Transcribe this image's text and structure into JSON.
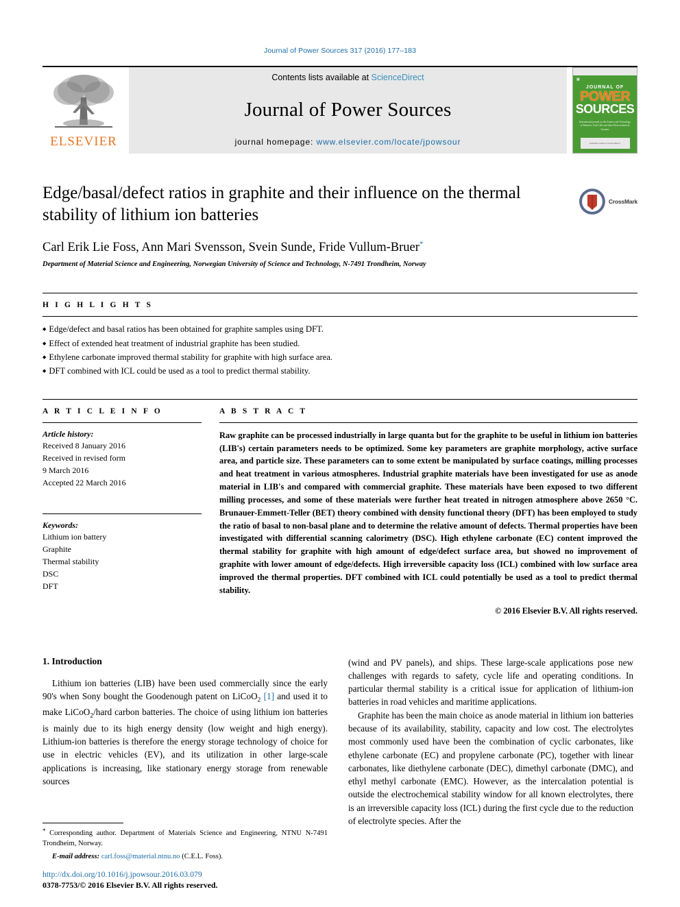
{
  "running_head": "Journal of Power Sources 317 (2016) 177–183",
  "masthead": {
    "publisher_name": "ELSEVIER",
    "contents_prefix": "Contents lists available at ",
    "contents_link": "ScienceDirect",
    "journal_name": "Journal of Power Sources",
    "homepage_prefix": "journal homepage: ",
    "homepage_url": "www.elsevier.com/locate/jpowsour",
    "cover": {
      "line1": "JOURNAL OF",
      "line2": "POWER",
      "line3": "SOURCES",
      "blurb": "International journal on the Science and Technology of Batteries, Fuel Cells and other Electrochemical Systems",
      "footer": "Available online at ScienceDirect"
    }
  },
  "article": {
    "title": "Edge/basal/defect ratios in graphite and their influence on the thermal stability of lithium ion batteries",
    "authors": "Carl Erik Lie Foss, Ann Mari Svensson, Svein Sunde, Fride Vullum-Bruer",
    "author_star": "*",
    "affiliation": "Department of Material Science and Engineering, Norwegian University of Science and Technology, N-7491 Trondheim, Norway",
    "crossmark_label": "CrossMark"
  },
  "highlights": {
    "heading": "H I G H L I G H T S",
    "items": [
      "Edge/defect and basal ratios has been obtained for graphite samples using DFT.",
      "Effect of extended heat treatment of industrial graphite has been studied.",
      "Ethylene carbonate improved thermal stability for graphite with high surface area.",
      "DFT combined with ICL could be used as a tool to predict thermal stability."
    ]
  },
  "article_info": {
    "heading": "A R T I C L E   I N F O",
    "history_label": "Article history:",
    "history": [
      "Received 8 January 2016",
      "Received in revised form",
      "9 March 2016",
      "Accepted 22 March 2016"
    ],
    "keywords_label": "Keywords:",
    "keywords": [
      "Lithium ion battery",
      "Graphite",
      "Thermal stability",
      "DSC",
      "DFT"
    ]
  },
  "abstract": {
    "heading": "A B S T R A C T",
    "text": "Raw graphite can be processed industrially in large quanta but for the graphite to be useful in lithium ion batteries (LIB's) certain parameters needs to be optimized. Some key parameters are graphite morphology, active surface area, and particle size. These parameters can to some extent be manipulated by surface coatings, milling processes and heat treatment in various atmospheres. Industrial graphite materials have been investigated for use as anode material in LIB's and compared with commercial graphite. These materials have been exposed to two different milling processes, and some of these materials were further heat treated in nitrogen atmosphere above 2650 °C. Brunauer-Emmett-Teller (BET) theory combined with density functional theory (DFT) has been employed to study the ratio of basal to non-basal plane and to determine the relative amount of defects. Thermal properties have been investigated with differential scanning calorimetry (DSC). High ethylene carbonate (EC) content improved the thermal stability for graphite with high amount of edge/defect surface area, but showed no improvement of graphite with lower amount of edge/defects. High irreversible capacity loss (ICL) combined with low surface area improved the thermal properties. DFT combined with ICL could potentially be used as a tool to predict thermal stability.",
    "copyright": "© 2016 Elsevier B.V. All rights reserved."
  },
  "introduction": {
    "heading": "1. Introduction",
    "left_p1_a": "Lithium ion batteries (LIB) have been used commercially since the early 90's when Sony bought the Goodenough patent on LiCoO",
    "left_p1_sub1": "2",
    "left_p1_ref": "[1]",
    "left_p1_b": " and used it to make LiCoO",
    "left_p1_sub2": "2",
    "left_p1_c": "/hard carbon batteries. The choice of using lithium ion batteries is mainly due to its high energy density (low weight and high energy). Lithium-ion batteries is therefore the energy storage technology of choice for use in electric vehicles (EV), and its utilization in other large-scale applications is increasing, like stationary energy storage from renewable sources",
    "right_p1": "(wind and PV panels), and ships. These large-scale applications pose new challenges with regards to safety, cycle life and operating conditions. In particular thermal stability is a critical issue for application of lithium-ion batteries in road vehicles and maritime applications.",
    "right_p2": "Graphite has been the main choice as anode material in lithium ion batteries because of its availability, stability, capacity and low cost. The electrolytes most commonly used have been the combination of cyclic carbonates, like ethylene carbonate (EC) and propylene carbonate (PC), together with linear carbonates, like diethylene carbonate (DEC), dimethyl carbonate (DMC), and ethyl methyl carbonate (EMC). However, as the intercalation potential is outside the electrochemical stability window for all known electrolytes, there is an irreversible capacity loss (ICL) during the first cycle due to the reduction of electrolyte species. After the"
  },
  "footnotes": {
    "corresponding": "Corresponding author. Department of Materials Science and Engineering, NTNU N-7491 Trondheim, Norway.",
    "email_label": "E-mail address:",
    "email": "carl.foss@material.ntnu.no",
    "email_suffix": "(C.E.L. Foss).",
    "doi": "http://dx.doi.org/10.1016/j.jpowsour.2016.03.079",
    "issn": "0378-7753/© 2016 Elsevier B.V. All rights reserved."
  },
  "colors": {
    "link": "#1a6ca8",
    "elsevier_orange": "#e77726",
    "cover_green": "#4b9b35",
    "masthead_grey": "#e8e8e8"
  }
}
